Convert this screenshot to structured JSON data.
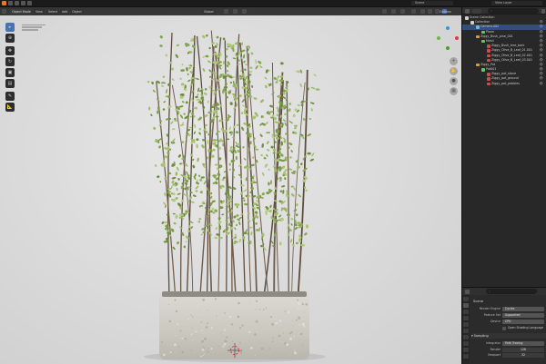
{
  "topbar": {
    "scene_label": "Scene",
    "view_layer_label": "View Layer"
  },
  "viewport": {
    "mode_label": "Object Mode",
    "menus": [
      "View",
      "Select",
      "Add",
      "Object"
    ],
    "transform_orientation": "Global",
    "options_label": "Options"
  },
  "outliner": {
    "search_placeholder": "",
    "rows": [
      {
        "label": "Scene Collection",
        "indent": 1,
        "icon_color": "#cfcfcf",
        "selected": false
      },
      {
        "label": "Collection",
        "indent": 3,
        "icon_color": "#cfcfcf",
        "selected": false
      },
      {
        "label": "Camera.002",
        "indent": 5,
        "icon_color": "#7db3e0",
        "selected": true
      },
      {
        "label": "Plane",
        "indent": 7,
        "icon_color": "#6ac46a",
        "selected": false
      },
      {
        "label": "Ziggy_Bush_pine_001",
        "indent": 5,
        "icon_color": "#e39b42",
        "selected": false
      },
      {
        "label": "Mesh",
        "indent": 7,
        "icon_color": "#6ac46a",
        "selected": false
      },
      {
        "label": "Ziggy_Bush_tree_bark",
        "indent": 9,
        "icon_color": "#d24a4a",
        "selected": false
      },
      {
        "label": "Ziggy_Olive_B_Leaf_01.001",
        "indent": 9,
        "icon_color": "#d24a4a",
        "selected": false
      },
      {
        "label": "Ziggy_Olive_B_Leaf_02.001",
        "indent": 9,
        "icon_color": "#d24a4a",
        "selected": false
      },
      {
        "label": "Ziggy_Olive_B_Leaf_03.001",
        "indent": 9,
        "icon_color": "#d24a4a",
        "selected": false
      },
      {
        "label": "Ziggy_Pot",
        "indent": 5,
        "icon_color": "#e39b42",
        "selected": false
      },
      {
        "label": "Pot001",
        "indent": 7,
        "icon_color": "#6ac46a",
        "selected": false
      },
      {
        "label": "Ziggy_pot_stone",
        "indent": 9,
        "icon_color": "#d24a4a",
        "selected": false
      },
      {
        "label": "Ziggy_pot_ground",
        "indent": 9,
        "icon_color": "#d24a4a",
        "selected": false
      },
      {
        "label": "Ziggy_pot_pebbles",
        "indent": 9,
        "icon_color": "#d24a4a",
        "selected": false
      }
    ]
  },
  "properties": {
    "title": "Scene",
    "render_engine_label": "Render Engine",
    "render_engine_value": "Cycles",
    "feature_set_label": "Feature Set",
    "feature_set_value": "Supported",
    "device_label": "Device",
    "device_value": "CPU",
    "osl_label": "Open Shading Language",
    "sampling_label": "Sampling",
    "integrator_label": "Integrator",
    "integrator_value": "Path Tracing",
    "render_label": "Render",
    "render_value": "128",
    "viewport_label": "Viewport",
    "viewport_value": "32"
  },
  "colors": {
    "accent": "#4772b3",
    "selection": "#334d80",
    "leaf": "#8fae55",
    "pot": "#cfcdc6"
  },
  "icons": [
    "select-icon",
    "cursor-icon",
    "move-icon",
    "rotate-icon",
    "scale-icon",
    "transform-icon",
    "annotate-icon",
    "measure-icon"
  ]
}
